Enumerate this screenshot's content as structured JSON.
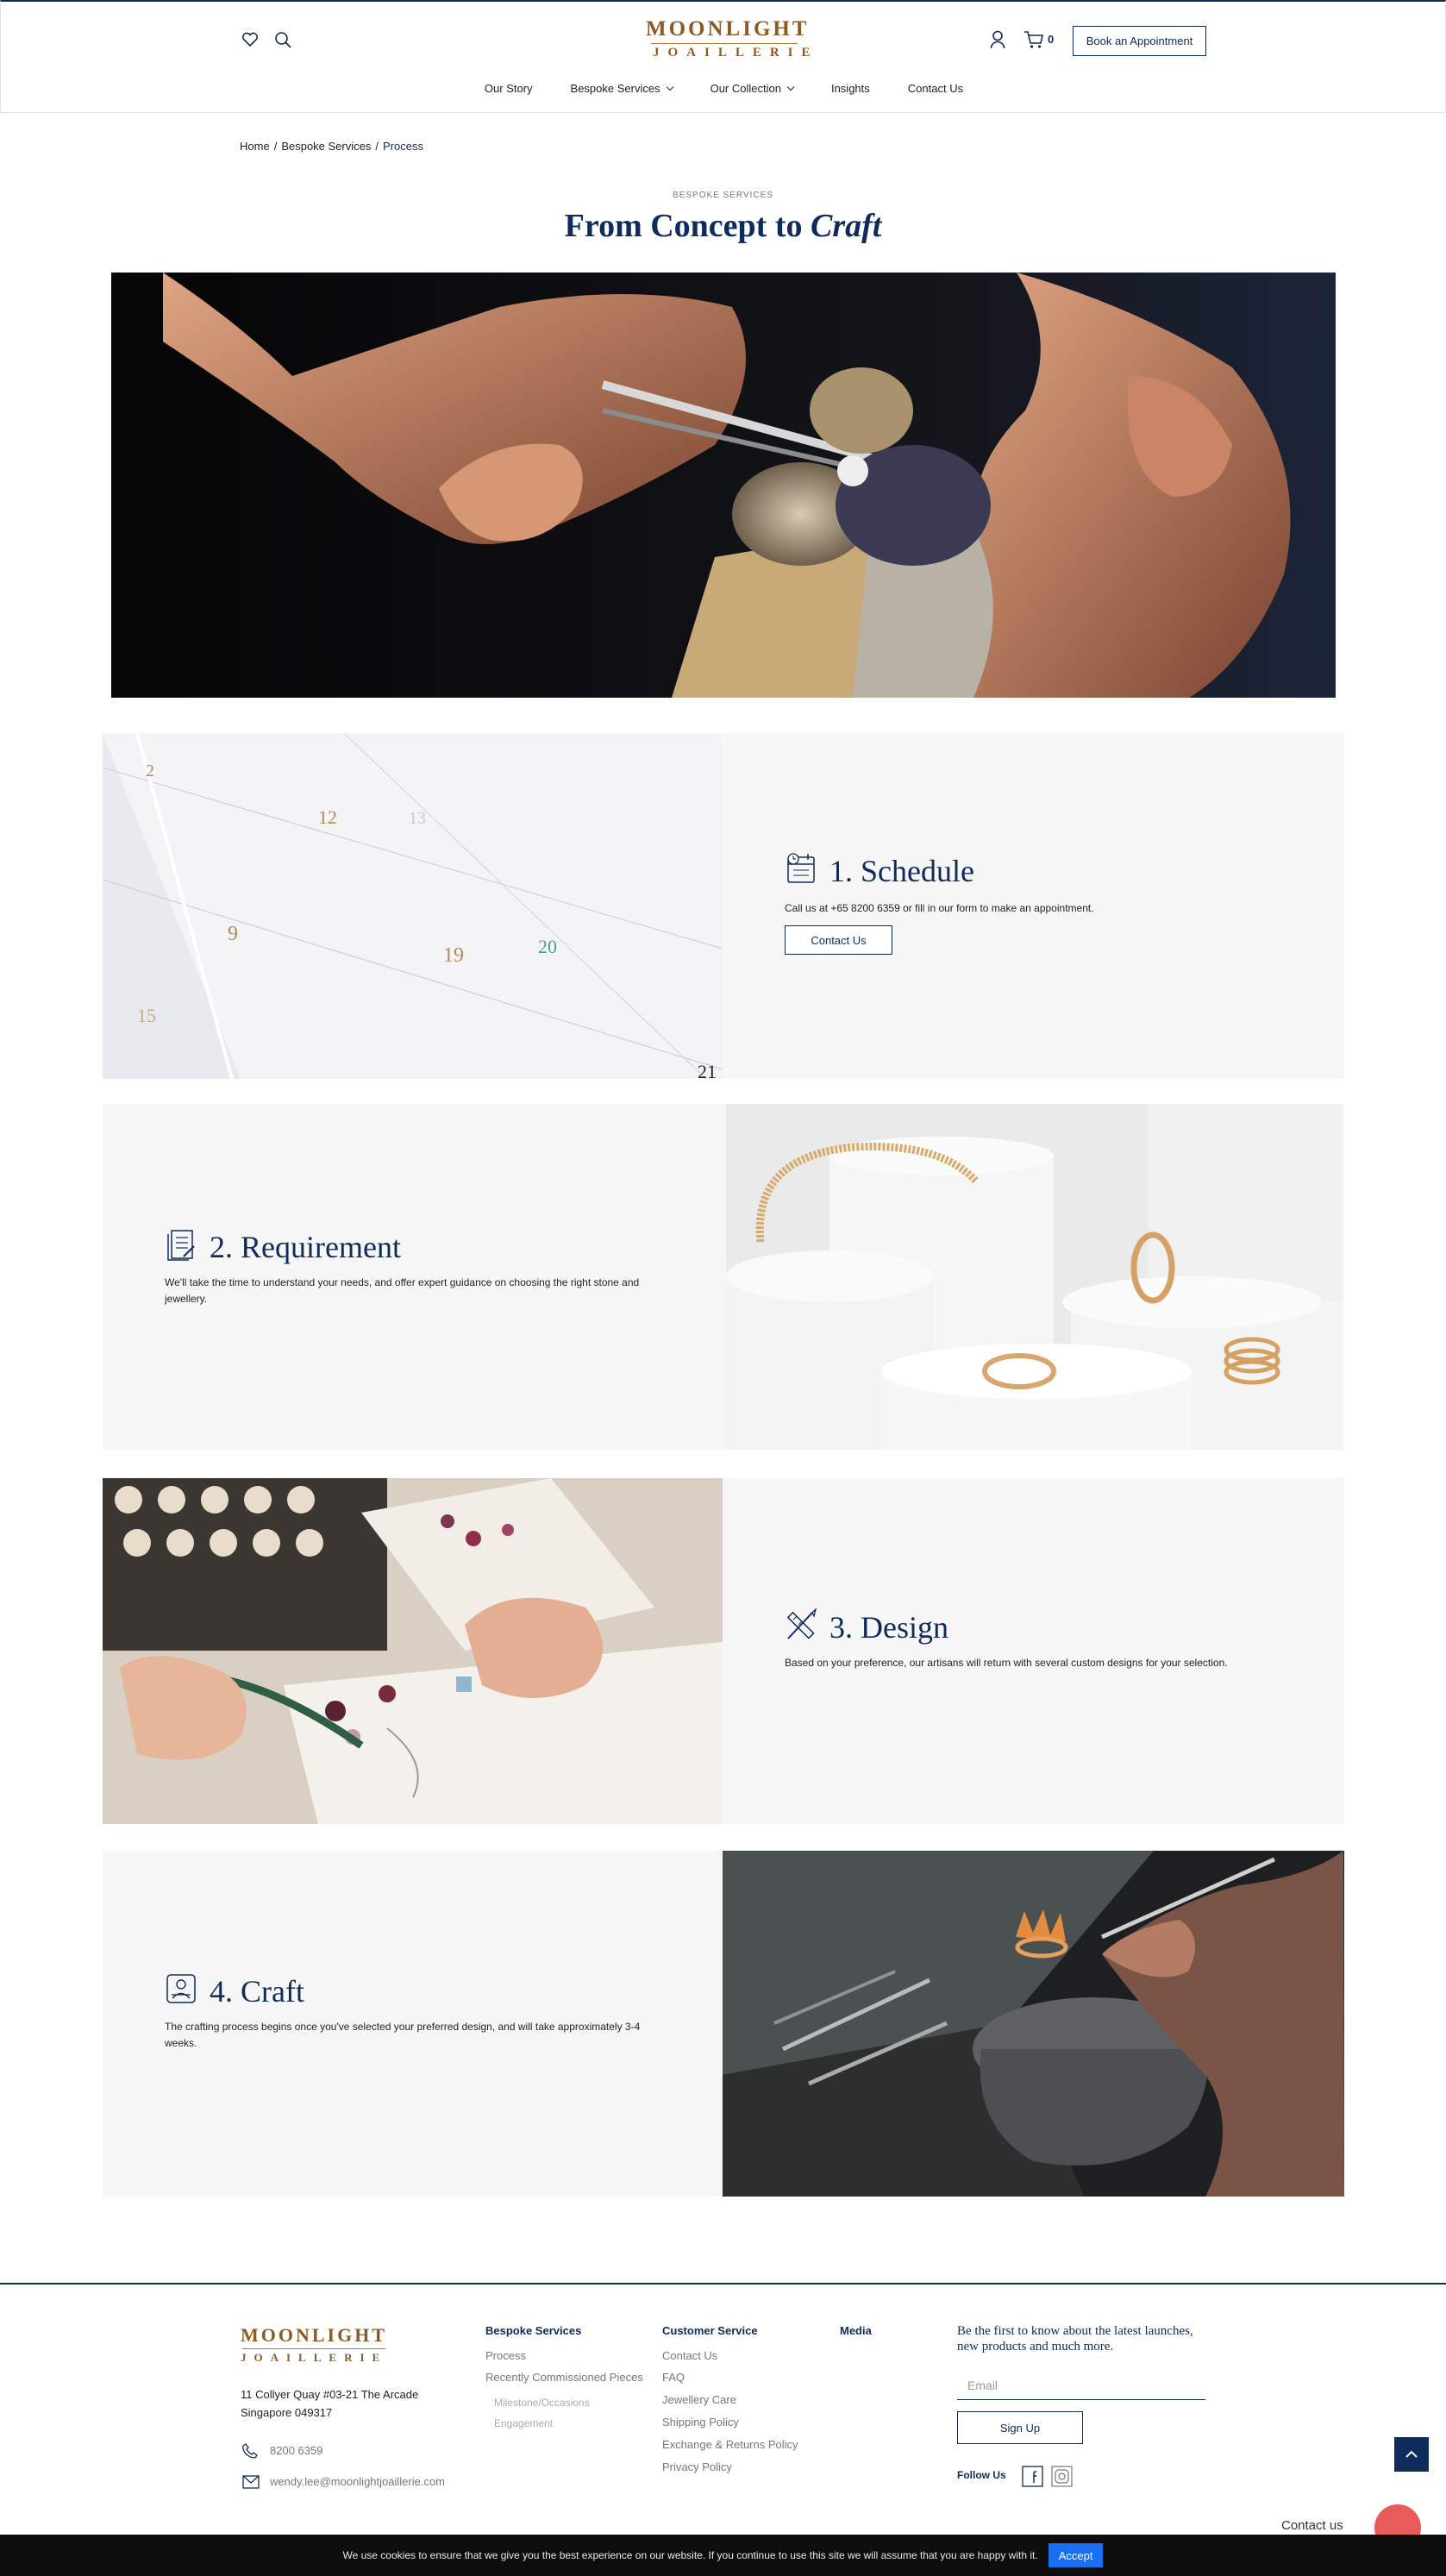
{
  "header": {
    "logo_top": "MOONLIGHT",
    "logo_bottom": "JOAILLERIE",
    "cart_count": "0",
    "book_label": "Book an Appointment",
    "nav": [
      {
        "label": "Our Story"
      },
      {
        "label": "Bespoke Services"
      },
      {
        "label": "Our Collection"
      },
      {
        "label": "Insights"
      },
      {
        "label": "Contact Us"
      }
    ]
  },
  "breadcrumb": {
    "home": "Home",
    "parent": "Bespoke Services",
    "current": "Process"
  },
  "page": {
    "eyebrow": "BESPOKE SERVICES",
    "title_main": "From Concept to",
    "title_italic": "Craft"
  },
  "steps": [
    {
      "title": "1. Schedule",
      "desc": "Call us at +65 8200 6359 or fill in our form to make an appointment.",
      "button": "Contact Us",
      "icon": "calendar-icon"
    },
    {
      "title": "2. Requirement",
      "desc": "We'll take the time to understand your needs, and offer expert guidance on choosing the right stone and jewellery.",
      "icon": "document-icon"
    },
    {
      "title": "3. Design",
      "desc": "Based on your preference, our artisans will return with several custom designs for your selection.",
      "icon": "pencil-ruler-icon"
    },
    {
      "title": "4. Craft",
      "desc": "The crafting process begins once you've selected your preferred design, and will take approximately 3-4 weeks.",
      "icon": "craftsman-icon"
    }
  ],
  "calendar_numbers": [
    "2",
    "12",
    "13",
    "9",
    "19",
    "20",
    "15",
    "21"
  ],
  "footer": {
    "logo_top": "MOONLIGHT",
    "logo_bottom": "JOAILLERIE",
    "address_line1": "11 Collyer Quay #03-21 The Arcade",
    "address_line2": "Singapore 049317",
    "phone": "8200 6359",
    "email": "wendy.lee@moonlightjoaillerie.com",
    "bespoke_heading": "Bespoke Services",
    "bespoke_links": [
      "Process",
      "Recently Commissioned Pieces"
    ],
    "bespoke_sub": [
      "Milestone/Occasions",
      "Engagement"
    ],
    "customer_heading": "Customer Service",
    "customer_links": [
      "Contact Us",
      "FAQ",
      "Jewellery Care",
      "Shipping Policy",
      "Exchange & Returns Policy",
      "Privacy Policy"
    ],
    "media_heading": "Media",
    "newsletter_heading": "Be the first to know about the latest launches, new products and much more.",
    "email_placeholder": "Email",
    "signup_label": "Sign Up",
    "follow_label": "Follow Us"
  },
  "chat_label": "Contact us",
  "cookie": {
    "text": "We use cookies to ensure that we give you the best experience on our website. If you continue to use this site we will assume that you are happy with it.",
    "accept": "Accept"
  },
  "colors": {
    "navy": "#0f2b5b",
    "gold": "#8d5a26",
    "accent_blue": "#1a6ff0"
  }
}
